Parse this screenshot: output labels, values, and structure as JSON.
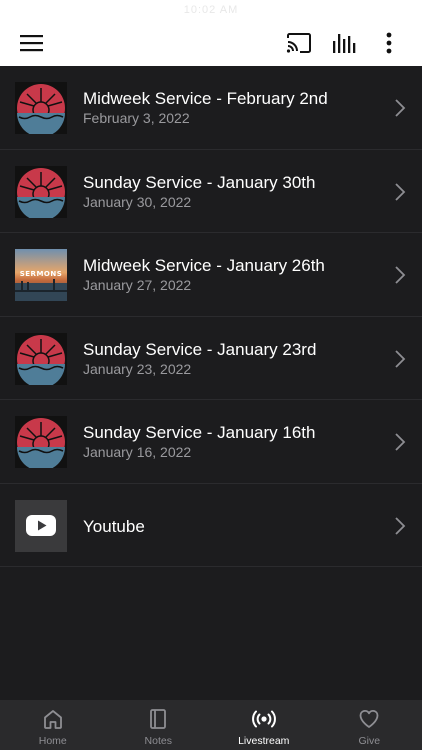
{
  "status_bar": {
    "time": "10:02 AM"
  },
  "toolbar": {
    "menu_icon": "hamburger-menu-icon",
    "cast_icon": "cast-icon",
    "audio_icon": "audio-levels-icon",
    "more_icon": "more-vertical-icon"
  },
  "items": [
    {
      "title": "Midweek Service - February 2nd",
      "date": "February 3, 2022",
      "thumb": "sunset-logo"
    },
    {
      "title": "Sunday Service - January 30th",
      "date": "January 30, 2022",
      "thumb": "sunset-logo"
    },
    {
      "title": "Midweek Service - January 26th",
      "date": "January 27, 2022",
      "thumb": "sermons-photo",
      "thumb_text": "SERMONS"
    },
    {
      "title": "Sunday Service - January 23rd",
      "date": "January 23, 2022",
      "thumb": "sunset-logo"
    },
    {
      "title": "Sunday Service - January 16th",
      "date": "January 16, 2022",
      "thumb": "sunset-logo"
    },
    {
      "title": "Youtube",
      "date": "",
      "thumb": "youtube-logo"
    }
  ],
  "tabs": [
    {
      "label": "Home",
      "icon": "home-icon",
      "active": false
    },
    {
      "label": "Notes",
      "icon": "notes-icon",
      "active": false
    },
    {
      "label": "Livestream",
      "icon": "broadcast-icon",
      "active": true
    },
    {
      "label": "Give",
      "icon": "heart-icon",
      "active": false
    }
  ],
  "colors": {
    "background": "#1c1c1e",
    "topbar": "#ffffff",
    "tabbar": "#2a2a2c",
    "logo_red": "#c8394a",
    "logo_blue": "#4f7d98",
    "active_tab": "#ffffff",
    "inactive_tab": "#8e8e93"
  }
}
